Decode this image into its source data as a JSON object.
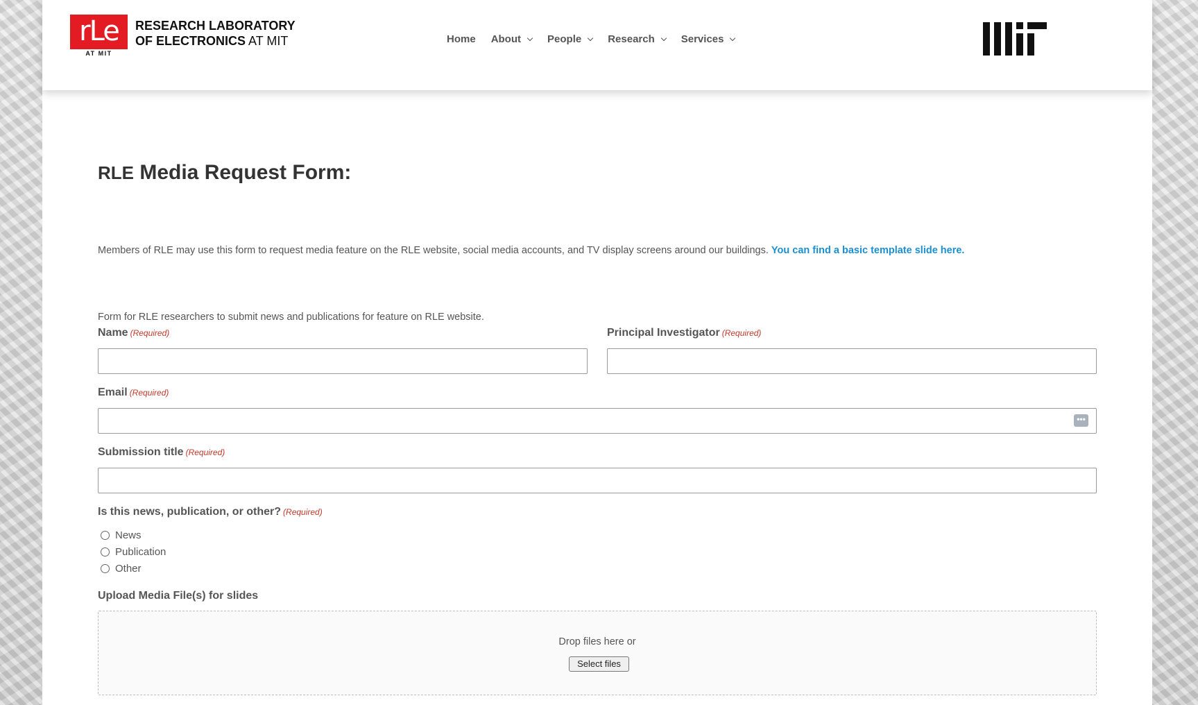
{
  "header": {
    "logo": {
      "mark": "rLe",
      "sub": "AT MIT"
    },
    "org_line1": "RESEARCH LABORATORY",
    "org_line2_bold": "OF ELECTRONICS",
    "org_line2_rest": "AT MIT",
    "nav": [
      {
        "label": "Home"
      },
      {
        "label": "About"
      },
      {
        "label": "People"
      },
      {
        "label": "Research"
      },
      {
        "label": "Services"
      }
    ],
    "partner_logo": "MIT"
  },
  "main": {
    "title_prefix": "RLE",
    "title_rest": " Media Request Form:",
    "intro": {
      "text": "Members of RLE may use this form to request media feature on the RLE website, social media accounts, and TV display screens around our buildings. ",
      "link": "You can find a basic template slide here."
    },
    "form_description": "Form for RLE researchers to submit news and publications for feature on RLE website.",
    "required_label": "(Required)",
    "fields": {
      "name": {
        "label": "Name",
        "value": ""
      },
      "pi": {
        "label": "Principal Investigator",
        "value": ""
      },
      "email": {
        "label": "Email",
        "value": "",
        "action_icon": "more-dots-icon"
      },
      "title": {
        "label": "Submission title",
        "value": ""
      },
      "type": {
        "label": "Is this news, publication, or other?",
        "options": [
          "News",
          "Publication",
          "Other"
        ],
        "selected": null
      },
      "upload": {
        "label": "Upload Media File(s) for slides",
        "drop_text": "Drop files here or",
        "button": "Select files"
      }
    }
  },
  "colors": {
    "brand_red": "#e31c23",
    "link_blue": "#1a8fd1",
    "required_red": "#c0392b"
  }
}
